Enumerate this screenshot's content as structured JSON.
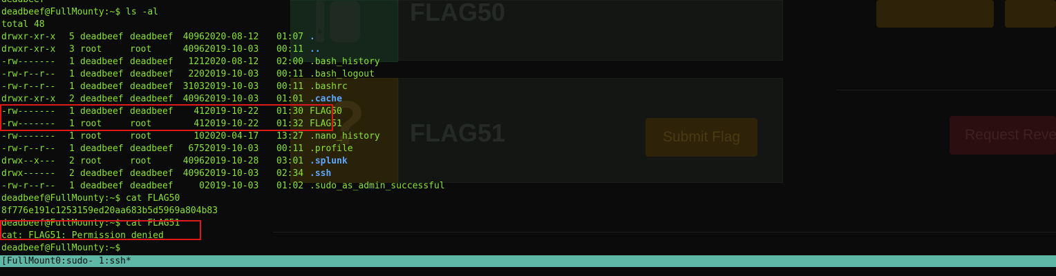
{
  "background_page": {
    "flags": [
      {
        "title": "FLAG50",
        "icon": "unlocked-flag-icon",
        "state_color": "#14271a"
      },
      {
        "title": "FLAG51",
        "icon": "question-mark-icon",
        "state_color": "#2a2208"
      }
    ],
    "submit_button_label": "Submit Flag",
    "request_button_label": "Request Reve"
  },
  "terminal": {
    "prompt": "deadbeef@FullMounty:~$",
    "top_partial": "deadbeef",
    "cmd1": "ls -al",
    "total": "total 48",
    "entries": [
      {
        "perm": "drwxr-xr-x",
        "n": "5",
        "owner": "deadbeef",
        "group": "deadbeef",
        "size": "4096",
        "date": "2020-08-12",
        "time": "01:07",
        "name": ".",
        "type": "dir"
      },
      {
        "perm": "drwxr-xr-x",
        "n": "3",
        "owner": "root",
        "group": "root",
        "size": "4096",
        "date": "2019-10-03",
        "time": "00:11",
        "name": "..",
        "type": "dir"
      },
      {
        "perm": "-rw-------",
        "n": "1",
        "owner": "deadbeef",
        "group": "deadbeef",
        "size": "121",
        "date": "2020-08-12",
        "time": "02:00",
        "name": ".bash_history",
        "type": "file"
      },
      {
        "perm": "-rw-r--r--",
        "n": "1",
        "owner": "deadbeef",
        "group": "deadbeef",
        "size": "220",
        "date": "2019-10-03",
        "time": "00:11",
        "name": ".bash_logout",
        "type": "file"
      },
      {
        "perm": "-rw-r--r--",
        "n": "1",
        "owner": "deadbeef",
        "group": "deadbeef",
        "size": "3103",
        "date": "2019-10-03",
        "time": "00:11",
        "name": ".bashrc",
        "type": "file"
      },
      {
        "perm": "drwxr-xr-x",
        "n": "2",
        "owner": "deadbeef",
        "group": "deadbeef",
        "size": "4096",
        "date": "2019-10-03",
        "time": "01:01",
        "name": ".cache",
        "type": "dir"
      },
      {
        "perm": "-rw-------",
        "n": "1",
        "owner": "deadbeef",
        "group": "deadbeef",
        "size": "41",
        "date": "2019-10-22",
        "time": "01:30",
        "name": "FLAG50",
        "type": "file"
      },
      {
        "perm": "-rw-------",
        "n": "1",
        "owner": "root",
        "group": "root",
        "size": "41",
        "date": "2019-10-22",
        "time": "01:32",
        "name": "FLAG51",
        "type": "file"
      },
      {
        "perm": "-rw-------",
        "n": "1",
        "owner": "root",
        "group": "root",
        "size": "10",
        "date": "2020-04-17",
        "time": "13:27",
        "name": ".nano_history",
        "type": "file"
      },
      {
        "perm": "-rw-r--r--",
        "n": "1",
        "owner": "deadbeef",
        "group": "deadbeef",
        "size": "675",
        "date": "2019-10-03",
        "time": "00:11",
        "name": ".profile",
        "type": "file"
      },
      {
        "perm": "drwx--x---",
        "n": "2",
        "owner": "root",
        "group": "root",
        "size": "4096",
        "date": "2019-10-28",
        "time": "03:01",
        "name": ".splunk",
        "type": "dir"
      },
      {
        "perm": "drwx------",
        "n": "2",
        "owner": "deadbeef",
        "group": "deadbeef",
        "size": "4096",
        "date": "2019-10-03",
        "time": "02:34",
        "name": ".ssh",
        "type": "dir"
      },
      {
        "perm": "-rw-r--r--",
        "n": "1",
        "owner": "deadbeef",
        "group": "deadbeef",
        "size": "0",
        "date": "2019-10-03",
        "time": "01:02",
        "name": ".sudo_as_admin_successful",
        "type": "file"
      }
    ],
    "cmd2": "cat FLAG50",
    "hash": "8f776e191c1253159ed20aa683b5d5969a804b83",
    "cmd3": "cat FLAG51",
    "error": "cat: FLAG51: Permission denied",
    "colors": {
      "text": "#8ae234",
      "dir": "#5ea7ff",
      "highlight": "#e01818"
    }
  },
  "status_bar": {
    "text": "[FullMount0:sudo- 1:ssh*",
    "color": "#5fb7a6"
  }
}
